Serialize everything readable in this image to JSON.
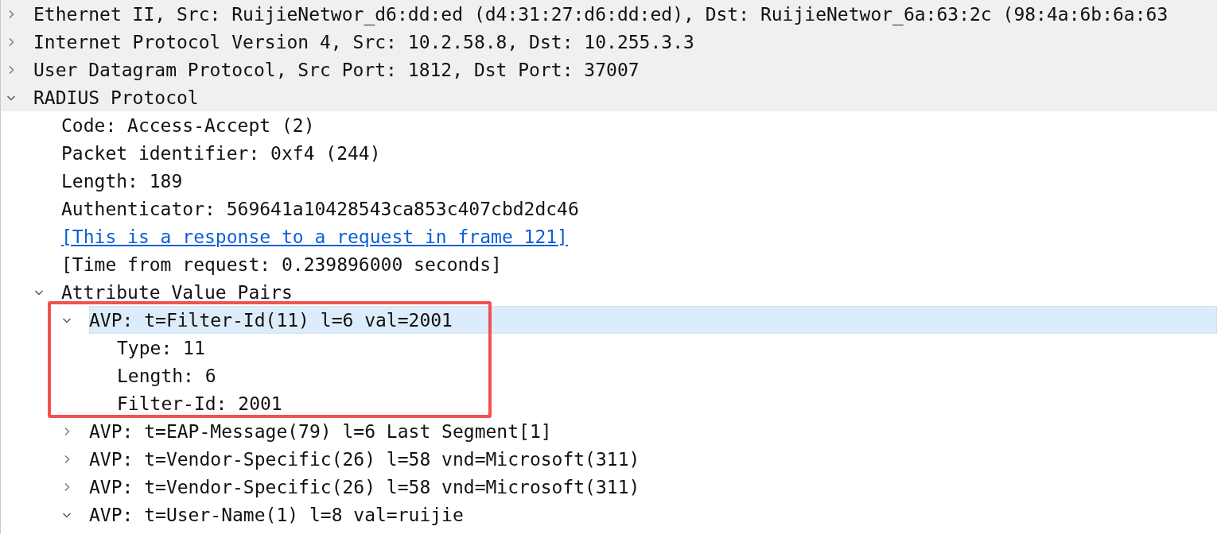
{
  "tree": [
    {
      "label": "Ethernet II, Src: RuijieNetwor_d6:dd:ed (d4:31:27:d6:dd:ed), Dst: RuijieNetwor_6a:63:2c (98:4a:6b:6a:63",
      "expanded": false,
      "selected": false
    },
    {
      "label": "Internet Protocol Version 4, Src: 10.2.58.8, Dst: 10.255.3.3",
      "expanded": false,
      "selected": false
    },
    {
      "label": "User Datagram Protocol, Src Port: 1812, Dst Port: 37007",
      "expanded": false,
      "selected": false
    },
    {
      "label": "RADIUS Protocol",
      "expanded": true,
      "selected": false,
      "children": [
        {
          "label": "Code: Access-Accept (2)",
          "selected": false
        },
        {
          "label": "Packet identifier: 0xf4 (244)",
          "selected": false
        },
        {
          "label": "Length: 189",
          "selected": false
        },
        {
          "label": "Authenticator: 569641a10428543ca853c407cbd2dc46",
          "selected": false
        },
        {
          "label": "[This is a response to a request in frame 121]",
          "kind": "link",
          "selected": false
        },
        {
          "label": "[Time from request: 0.239896000 seconds]",
          "selected": false
        },
        {
          "label": "Attribute Value Pairs",
          "expanded": true,
          "selected": false,
          "children": [
            {
              "label": "AVP: t=Filter-Id(11) l=6 val=2001",
              "expanded": true,
              "selected": true,
              "highlighted": true,
              "children": [
                {
                  "label": "Type: 11",
                  "selected": false
                },
                {
                  "label": "Length: 6",
                  "selected": false
                },
                {
                  "label": "Filter-Id: 2001",
                  "selected": false
                }
              ]
            },
            {
              "label": "AVP: t=EAP-Message(79) l=6 Last Segment[1]",
              "expanded": false,
              "selected": false
            },
            {
              "label": "AVP: t=Vendor-Specific(26) l=58 vnd=Microsoft(311)",
              "expanded": false,
              "selected": false
            },
            {
              "label": "AVP: t=Vendor-Specific(26) l=58 vnd=Microsoft(311)",
              "expanded": false,
              "selected": false
            },
            {
              "label": "AVP: t=User-Name(1) l=8 val=ruijie",
              "expanded": true,
              "selected": false
            }
          ]
        }
      ]
    }
  ]
}
